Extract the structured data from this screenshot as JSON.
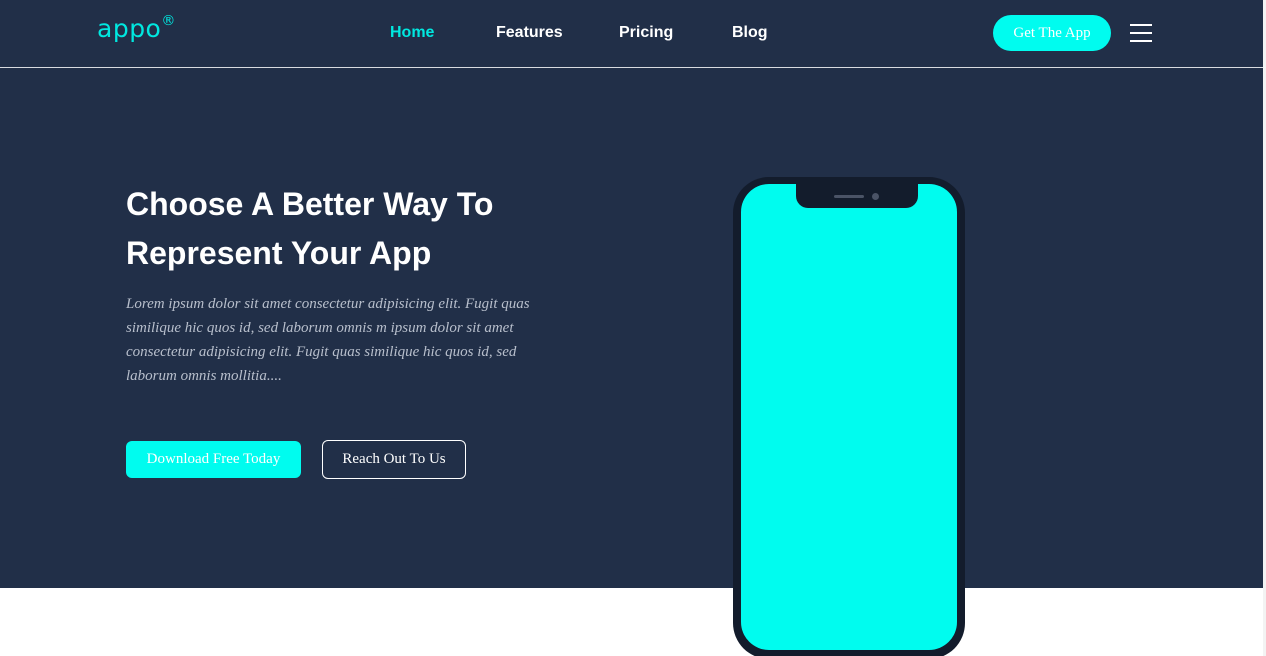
{
  "header": {
    "logo": "appo",
    "logo_mark": "®",
    "nav": [
      "Home",
      "Features",
      "Pricing",
      "Blog"
    ],
    "active_nav": "Home",
    "cta": "Get The App",
    "menu_icon": "hamburger-menu-icon"
  },
  "hero": {
    "title_line1": "Choose A Better Way To",
    "title_line2": "Represent Your App",
    "text": "Lorem ipsum dolor sit amet consectetur adipisicing elit. Fugit quas similique hic quos id, sed laborum omnis m ipsum dolor sit amet consectetur adipisicing elit. Fugit quas similique hic quos id, sed laborum omnis mollitia....",
    "primary_button": "Download Free Today",
    "secondary_button": "Reach Out To Us"
  },
  "colors": {
    "hero_background": "#212f48",
    "accent": "#00fcef",
    "phone_frame": "#131c2c",
    "text_white": "#ffffff"
  }
}
